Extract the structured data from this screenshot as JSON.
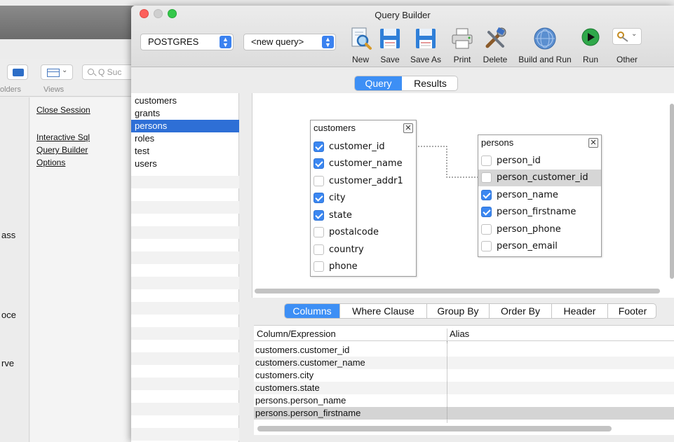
{
  "background_window": {
    "search_placeholder": "Q Suc",
    "folders_label": "olders",
    "views_label": "Views",
    "links": [
      "Close Session",
      "Interactive Sql",
      "Query Builder",
      "Options"
    ],
    "cut_labels": [
      "ass",
      "oce",
      "rve"
    ]
  },
  "window": {
    "title": "Query Builder",
    "database_select": "POSTGRES",
    "query_select": "<new query>"
  },
  "toolbar": {
    "new_label": "New",
    "save_label": "Save",
    "save_as_label": "Save As",
    "print_label": "Print",
    "delete_label": "Delete",
    "build_run_label": "Build and Run",
    "run_label": "Run",
    "other_label": "Other"
  },
  "view_tabs": [
    "Query",
    "Results"
  ],
  "tables_list": [
    "customers",
    "grants",
    "persons",
    "roles",
    "test",
    "users"
  ],
  "selected_table": "persons",
  "entities": {
    "customers": {
      "title": "customers",
      "fields": [
        {
          "name": "customer_id",
          "checked": true
        },
        {
          "name": "customer_name",
          "checked": true
        },
        {
          "name": "customer_addr1",
          "checked": false
        },
        {
          "name": "city",
          "checked": true
        },
        {
          "name": "state",
          "checked": true
        },
        {
          "name": "postalcode",
          "checked": false
        },
        {
          "name": "country",
          "checked": false
        },
        {
          "name": "phone",
          "checked": false
        }
      ]
    },
    "persons": {
      "title": "persons",
      "fields": [
        {
          "name": "person_id",
          "checked": false
        },
        {
          "name": "person_customer_id",
          "checked": false
        },
        {
          "name": "person_name",
          "checked": true
        },
        {
          "name": "person_firstname",
          "checked": true
        },
        {
          "name": "person_phone",
          "checked": false
        },
        {
          "name": "person_email",
          "checked": false
        }
      ]
    }
  },
  "bottom_tabs": [
    "Columns",
    "Where Clause",
    "Group By",
    "Order By",
    "Header",
    "Footer"
  ],
  "columns_grid": {
    "headers": [
      "Column/Expression",
      "Alias"
    ],
    "rows": [
      "customers.customer_id",
      "customers.customer_name",
      "customers.city",
      "customers.state",
      "persons.person_name",
      "persons.person_firstname"
    ]
  }
}
